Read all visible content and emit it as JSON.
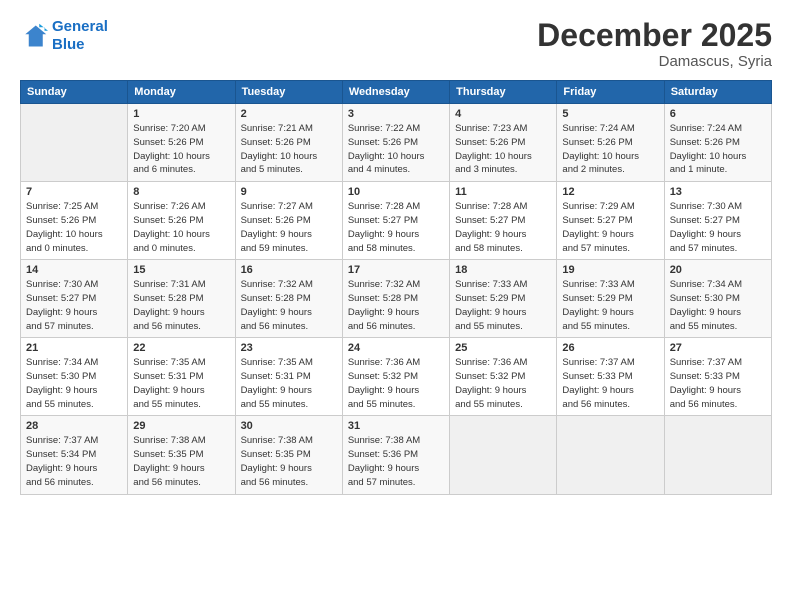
{
  "logo": {
    "line1": "General",
    "line2": "Blue"
  },
  "title": "December 2025",
  "location": "Damascus, Syria",
  "header_days": [
    "Sunday",
    "Monday",
    "Tuesday",
    "Wednesday",
    "Thursday",
    "Friday",
    "Saturday"
  ],
  "weeks": [
    [
      {
        "num": "",
        "info": ""
      },
      {
        "num": "1",
        "info": "Sunrise: 7:20 AM\nSunset: 5:26 PM\nDaylight: 10 hours\nand 6 minutes."
      },
      {
        "num": "2",
        "info": "Sunrise: 7:21 AM\nSunset: 5:26 PM\nDaylight: 10 hours\nand 5 minutes."
      },
      {
        "num": "3",
        "info": "Sunrise: 7:22 AM\nSunset: 5:26 PM\nDaylight: 10 hours\nand 4 minutes."
      },
      {
        "num": "4",
        "info": "Sunrise: 7:23 AM\nSunset: 5:26 PM\nDaylight: 10 hours\nand 3 minutes."
      },
      {
        "num": "5",
        "info": "Sunrise: 7:24 AM\nSunset: 5:26 PM\nDaylight: 10 hours\nand 2 minutes."
      },
      {
        "num": "6",
        "info": "Sunrise: 7:24 AM\nSunset: 5:26 PM\nDaylight: 10 hours\nand 1 minute."
      }
    ],
    [
      {
        "num": "7",
        "info": "Sunrise: 7:25 AM\nSunset: 5:26 PM\nDaylight: 10 hours\nand 0 minutes."
      },
      {
        "num": "8",
        "info": "Sunrise: 7:26 AM\nSunset: 5:26 PM\nDaylight: 10 hours\nand 0 minutes."
      },
      {
        "num": "9",
        "info": "Sunrise: 7:27 AM\nSunset: 5:26 PM\nDaylight: 9 hours\nand 59 minutes."
      },
      {
        "num": "10",
        "info": "Sunrise: 7:28 AM\nSunset: 5:27 PM\nDaylight: 9 hours\nand 58 minutes."
      },
      {
        "num": "11",
        "info": "Sunrise: 7:28 AM\nSunset: 5:27 PM\nDaylight: 9 hours\nand 58 minutes."
      },
      {
        "num": "12",
        "info": "Sunrise: 7:29 AM\nSunset: 5:27 PM\nDaylight: 9 hours\nand 57 minutes."
      },
      {
        "num": "13",
        "info": "Sunrise: 7:30 AM\nSunset: 5:27 PM\nDaylight: 9 hours\nand 57 minutes."
      }
    ],
    [
      {
        "num": "14",
        "info": "Sunrise: 7:30 AM\nSunset: 5:27 PM\nDaylight: 9 hours\nand 57 minutes."
      },
      {
        "num": "15",
        "info": "Sunrise: 7:31 AM\nSunset: 5:28 PM\nDaylight: 9 hours\nand 56 minutes."
      },
      {
        "num": "16",
        "info": "Sunrise: 7:32 AM\nSunset: 5:28 PM\nDaylight: 9 hours\nand 56 minutes."
      },
      {
        "num": "17",
        "info": "Sunrise: 7:32 AM\nSunset: 5:28 PM\nDaylight: 9 hours\nand 56 minutes."
      },
      {
        "num": "18",
        "info": "Sunrise: 7:33 AM\nSunset: 5:29 PM\nDaylight: 9 hours\nand 55 minutes."
      },
      {
        "num": "19",
        "info": "Sunrise: 7:33 AM\nSunset: 5:29 PM\nDaylight: 9 hours\nand 55 minutes."
      },
      {
        "num": "20",
        "info": "Sunrise: 7:34 AM\nSunset: 5:30 PM\nDaylight: 9 hours\nand 55 minutes."
      }
    ],
    [
      {
        "num": "21",
        "info": "Sunrise: 7:34 AM\nSunset: 5:30 PM\nDaylight: 9 hours\nand 55 minutes."
      },
      {
        "num": "22",
        "info": "Sunrise: 7:35 AM\nSunset: 5:31 PM\nDaylight: 9 hours\nand 55 minutes."
      },
      {
        "num": "23",
        "info": "Sunrise: 7:35 AM\nSunset: 5:31 PM\nDaylight: 9 hours\nand 55 minutes."
      },
      {
        "num": "24",
        "info": "Sunrise: 7:36 AM\nSunset: 5:32 PM\nDaylight: 9 hours\nand 55 minutes."
      },
      {
        "num": "25",
        "info": "Sunrise: 7:36 AM\nSunset: 5:32 PM\nDaylight: 9 hours\nand 55 minutes."
      },
      {
        "num": "26",
        "info": "Sunrise: 7:37 AM\nSunset: 5:33 PM\nDaylight: 9 hours\nand 56 minutes."
      },
      {
        "num": "27",
        "info": "Sunrise: 7:37 AM\nSunset: 5:33 PM\nDaylight: 9 hours\nand 56 minutes."
      }
    ],
    [
      {
        "num": "28",
        "info": "Sunrise: 7:37 AM\nSunset: 5:34 PM\nDaylight: 9 hours\nand 56 minutes."
      },
      {
        "num": "29",
        "info": "Sunrise: 7:38 AM\nSunset: 5:35 PM\nDaylight: 9 hours\nand 56 minutes."
      },
      {
        "num": "30",
        "info": "Sunrise: 7:38 AM\nSunset: 5:35 PM\nDaylight: 9 hours\nand 56 minutes."
      },
      {
        "num": "31",
        "info": "Sunrise: 7:38 AM\nSunset: 5:36 PM\nDaylight: 9 hours\nand 57 minutes."
      },
      {
        "num": "",
        "info": ""
      },
      {
        "num": "",
        "info": ""
      },
      {
        "num": "",
        "info": ""
      }
    ]
  ]
}
